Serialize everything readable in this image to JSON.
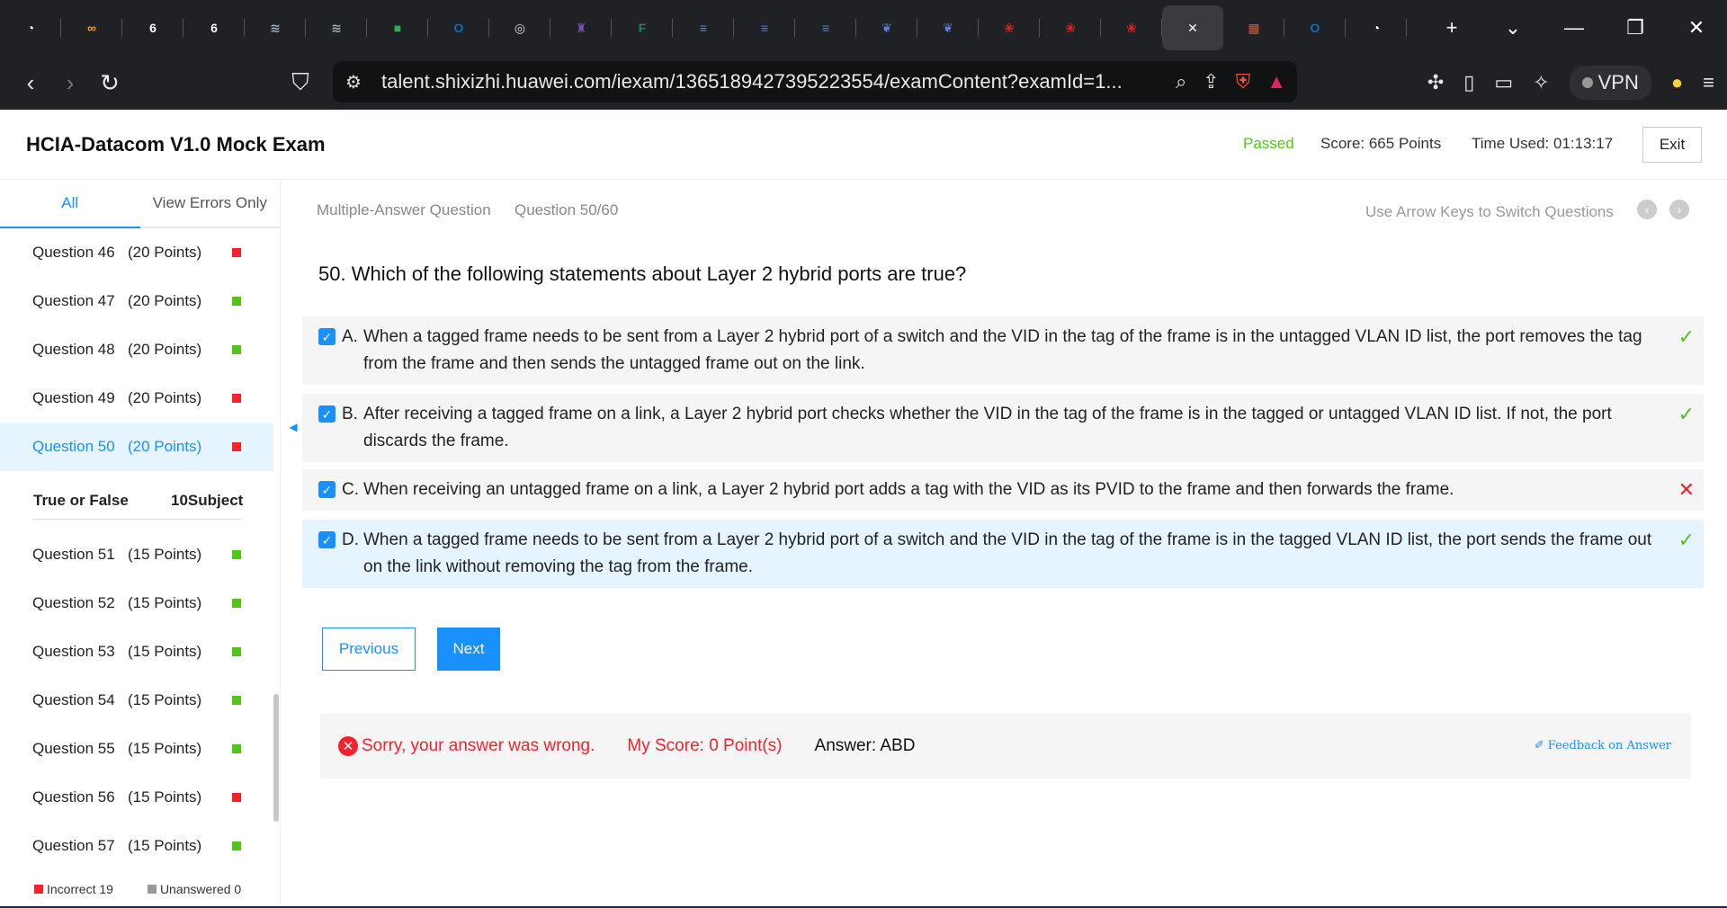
{
  "browser": {
    "tabs": [
      {
        "icon": "gauge-icon",
        "color": "#ffffff",
        "glyph": "◔"
      },
      {
        "icon": "copilot-icon",
        "color": "#f5a623",
        "glyph": "∞"
      },
      {
        "icon": "six-icon",
        "color": "#ffffff",
        "glyph": "6"
      },
      {
        "icon": "six-icon",
        "color": "#ffffff",
        "glyph": "6"
      },
      {
        "icon": "scroll-icon",
        "color": "#9ab",
        "glyph": "≋"
      },
      {
        "icon": "scroll-icon",
        "color": "#9ab",
        "glyph": "≋"
      },
      {
        "icon": "meet-icon",
        "color": "#34a853",
        "glyph": "■"
      },
      {
        "icon": "outlook-icon",
        "color": "#0f6cbd",
        "glyph": "O"
      },
      {
        "icon": "globe-icon",
        "color": "#dddddd",
        "glyph": "◎"
      },
      {
        "icon": "crest-icon",
        "color": "#7a4fb5",
        "glyph": "♜"
      },
      {
        "icon": "forms-icon",
        "color": "#138a5b",
        "glyph": "F"
      },
      {
        "icon": "docs-icon",
        "color": "#4285f4",
        "glyph": "≡"
      },
      {
        "icon": "docs-icon",
        "color": "#4285f4",
        "glyph": "≡"
      },
      {
        "icon": "docs-icon",
        "color": "#4285f4",
        "glyph": "≡"
      },
      {
        "icon": "bird-icon",
        "color": "#5b7fe0",
        "glyph": "❦"
      },
      {
        "icon": "bird-icon",
        "color": "#5b7fe0",
        "glyph": "❦"
      },
      {
        "icon": "huawei-icon",
        "color": "#e02020",
        "glyph": "❀"
      },
      {
        "icon": "huawei-icon",
        "color": "#e02020",
        "glyph": "❀"
      },
      {
        "icon": "huawei-icon",
        "color": "#e02020",
        "glyph": "❀"
      },
      {
        "icon": "close-icon",
        "color": "#ffffff",
        "glyph": "✕",
        "active": true
      },
      {
        "icon": "microsoft-icon",
        "color": "#f25022",
        "glyph": "▦"
      },
      {
        "icon": "outlook-icon",
        "color": "#0f6cbd",
        "glyph": "O"
      },
      {
        "icon": "gauge-icon",
        "color": "#ffffff",
        "glyph": "◔"
      }
    ],
    "url": "talent.shixizhi.huawei.com/iexam/1365189427395223554/examContent?examId=1...",
    "vpn_label": "VPN"
  },
  "header": {
    "title": "HCIA-Datacom V1.0 Mock Exam",
    "status": "Passed",
    "score": "Score:  665 Points",
    "time_used": "Time Used:  01:13:17",
    "exit_label": "Exit"
  },
  "sidebar": {
    "tabs": [
      "All",
      "View Errors Only"
    ],
    "questions_top": [
      {
        "num": "Question 46",
        "pts": "(20 Points)",
        "status": "incorrect"
      },
      {
        "num": "Question 47",
        "pts": "(20 Points)",
        "status": "correct"
      },
      {
        "num": "Question 48",
        "pts": "(20 Points)",
        "status": "correct"
      },
      {
        "num": "Question 49",
        "pts": "(20 Points)",
        "status": "incorrect"
      },
      {
        "num": "Question 50",
        "pts": "(20 Points)",
        "status": "incorrect",
        "current": true
      }
    ],
    "section": {
      "title": "True or False",
      "subject": "10Subject"
    },
    "questions_bottom": [
      {
        "num": "Question 51",
        "pts": "(15 Points)",
        "status": "correct"
      },
      {
        "num": "Question 52",
        "pts": "(15 Points)",
        "status": "correct"
      },
      {
        "num": "Question 53",
        "pts": "(15 Points)",
        "status": "correct"
      },
      {
        "num": "Question 54",
        "pts": "(15 Points)",
        "status": "correct"
      },
      {
        "num": "Question 55",
        "pts": "(15 Points)",
        "status": "correct"
      },
      {
        "num": "Question 56",
        "pts": "(15 Points)",
        "status": "incorrect"
      },
      {
        "num": "Question 57",
        "pts": "(15 Points)",
        "status": "correct"
      }
    ],
    "legend": {
      "incorrect": "Incorrect 19",
      "unanswered": "Unanswered 0"
    }
  },
  "colors": {
    "correct": "#52c41a",
    "incorrect": "#f5222d",
    "unanswered": "#999999",
    "accent": "#1890ff"
  },
  "main": {
    "question_type": "Multiple-Answer Question",
    "question_number": "Question 50/60",
    "arrow_hint": "Use Arrow Keys to Switch Questions",
    "question_text": "50. Which of the following statements about Layer 2 hybrid ports are true?",
    "options": [
      {
        "letter": "A.",
        "text": "When a tagged frame needs to be sent from a Layer 2 hybrid port of a switch and the VID in the tag of the frame is in the untagged VLAN ID list, the port removes the tag from the frame and then sends the untagged frame out on the link.",
        "result": "✓",
        "correct": true
      },
      {
        "letter": "B.",
        "text": "After receiving a tagged frame on a link, a Layer 2 hybrid port checks whether the VID in the tag of the frame is in the tagged or untagged VLAN ID list. If not, the port discards the frame.",
        "result": "✓",
        "correct": true
      },
      {
        "letter": "C.",
        "text": "When receiving an untagged frame on a link, a Layer 2 hybrid port adds a tag with the VID as its PVID to the frame and then forwards the frame.",
        "result": "✕",
        "correct": false
      },
      {
        "letter": "D.",
        "text": "When a tagged frame needs to be sent from a Layer 2 hybrid port of a switch and the VID in the tag of the frame is in the tagged VLAN ID list, the port sends the frame out on the link without removing the tag from the frame.",
        "result": "✓",
        "correct": true
      }
    ],
    "prev_label": "Previous",
    "next_label": "Next",
    "result": {
      "message": "Sorry, your answer was wrong.",
      "my_score": "My Score:  0 Point(s)",
      "answer": "Answer:  ABD",
      "feedback": "✐ Feedback on Answer"
    }
  }
}
